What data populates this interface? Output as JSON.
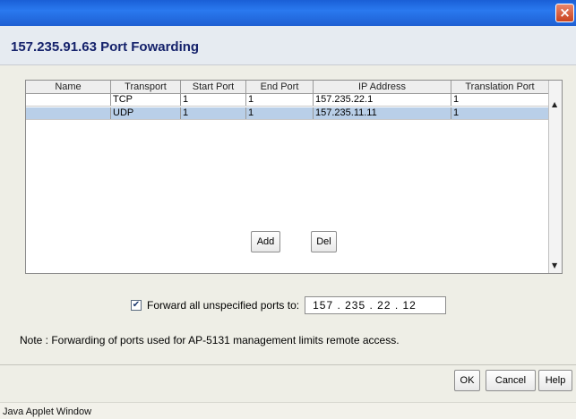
{
  "window": {
    "close_icon": "close-icon",
    "close_glyph": "×"
  },
  "dialog": {
    "title": "157.235.91.63 Port Fowarding"
  },
  "table": {
    "columns": [
      "Name",
      "Transport",
      "Start Port",
      "End Port",
      "IP Address",
      "Translation Port"
    ],
    "rows": [
      [
        "",
        "TCP",
        "1",
        "1",
        "157.235.22.1",
        "1"
      ],
      [
        "",
        "UDP",
        "1",
        "1",
        "157.235.11.11",
        "1"
      ]
    ],
    "selected_row": 1,
    "scroll_up_glyph": "▲",
    "scroll_down_glyph": "▼"
  },
  "buttons": {
    "add": "Add",
    "del": "Del",
    "ok": "OK",
    "cancel": "Cancel",
    "help": "Help"
  },
  "forward": {
    "checked": true,
    "check_glyph": "✔",
    "label": "Forward all unspecified ports to:",
    "ip_value": "157 . 235 . 22 . 12"
  },
  "note": "Note : Forwarding of ports used for AP-5131 management limits remote access.",
  "status_bar": "Java Applet Window",
  "colors": {
    "titlebar": "#2a79ef",
    "title_text": "#15226b",
    "selected_row": "#b9cfe8",
    "dialog_bg": "#eeeee6"
  }
}
